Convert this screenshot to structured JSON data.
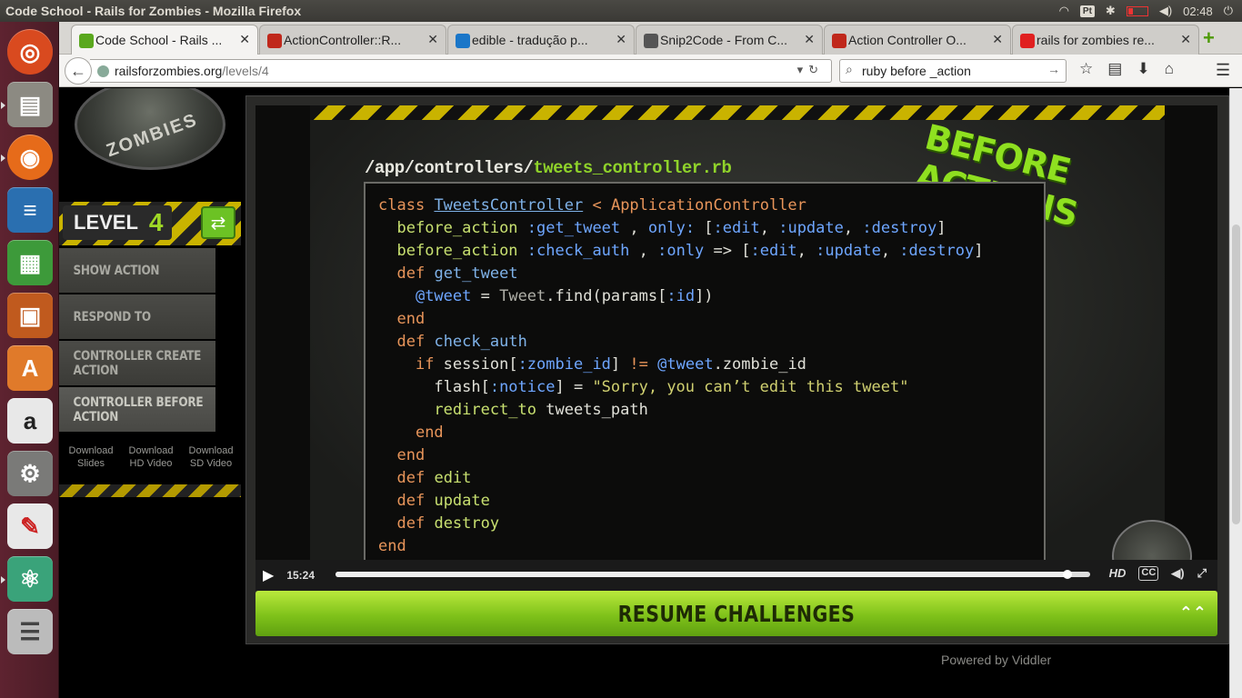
{
  "window_title": "Code School - Rails for Zombies - Mozilla Firefox",
  "tray": {
    "keyboard": "Pt",
    "clock": "02:48"
  },
  "launcher": [
    "ubuntu-dash-icon",
    "files-icon",
    "firefox-icon",
    "writer-icon",
    "calc-icon",
    "impress-icon",
    "software-center-icon",
    "amazon-icon",
    "system-settings-icon",
    "pdf-icon",
    "atom-icon",
    "stack-icon"
  ],
  "tabs": [
    {
      "title": "Code School - Rails ...",
      "fav": "#5aa81e"
    },
    {
      "title": "ActionController::R...",
      "fav": "#c0281b"
    },
    {
      "title": "edible - tradução p...",
      "fav": "#1a76c8"
    },
    {
      "title": "Snip2Code - From C...",
      "fav": "#555"
    },
    {
      "title": "Action Controller O...",
      "fav": "#c0281b"
    },
    {
      "title": "rails for zombies re...",
      "fav": "#e02020"
    }
  ],
  "url": {
    "domain": "railsforzombies.org",
    "path": "/levels/4"
  },
  "search": {
    "value": "ruby before _action"
  },
  "sidebar": {
    "level_label": "LEVEL",
    "level_number": "4",
    "logo_text": "ZOMBIES",
    "items": [
      "SHOW ACTION",
      "RESPOND TO",
      "CONTROLLER CREATE ACTION",
      "CONTROLLER BEFORE ACTION"
    ],
    "downloads": [
      "Download Slides",
      "Download HD Video",
      "Download SD Video"
    ]
  },
  "video": {
    "path_dir": "/app/controllers/",
    "path_file": "tweets_controller.rb",
    "badge": "BEFORE ACTIONS",
    "time": "15:24",
    "progress": 0.97,
    "hd": "HD",
    "cc": "CC"
  },
  "resume_label": "RESUME CHALLENGES",
  "powered_by": "Powered by Viddler"
}
